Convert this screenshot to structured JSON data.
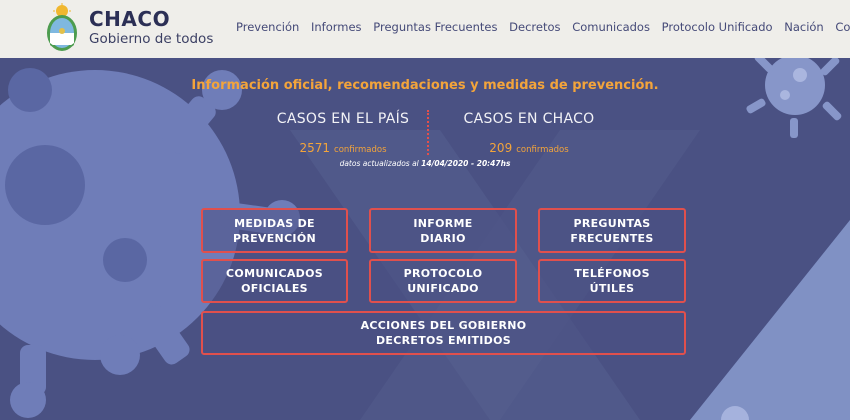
{
  "header": {
    "brand_title": "CHACO",
    "brand_subtitle": "Gobierno de todos",
    "nav": [
      "Prevención",
      "Informes",
      "Preguntas Frecuentes",
      "Decretos",
      "Comunicados",
      "Protocolo Unificado",
      "Nación",
      "Contacto"
    ]
  },
  "main": {
    "subtitle": "Información oficial, recomendaciones y medidas de prevención.",
    "stats": [
      {
        "title": "CASOS EN EL PAÍS",
        "number": "2571",
        "unit": "confirmados"
      },
      {
        "title": "CASOS EN CHACO",
        "number": "209",
        "unit": "confirmados"
      }
    ],
    "updated_prefix": "datos actualizados al",
    "updated_value": "14/04/2020 - 20:47hs",
    "buttons": [
      "MEDIDAS DE\nPREVENCIÓN",
      "INFORME\nDIARIO",
      "PREGUNTAS\nFRECUENTES",
      "COMUNICADOS\nOFICIALES",
      "PROTOCOLO\nUNIFICADO",
      "TELÉFONOS\nÚTILES",
      "ACCIONES DEL GOBIERNO\nDECRETOS EMITIDOS"
    ]
  },
  "colors": {
    "background": "#4a5183",
    "header": "#efeeea",
    "accent_orange": "#f3a43b",
    "button_border": "#e0504d",
    "virus": "#6f7db8"
  }
}
